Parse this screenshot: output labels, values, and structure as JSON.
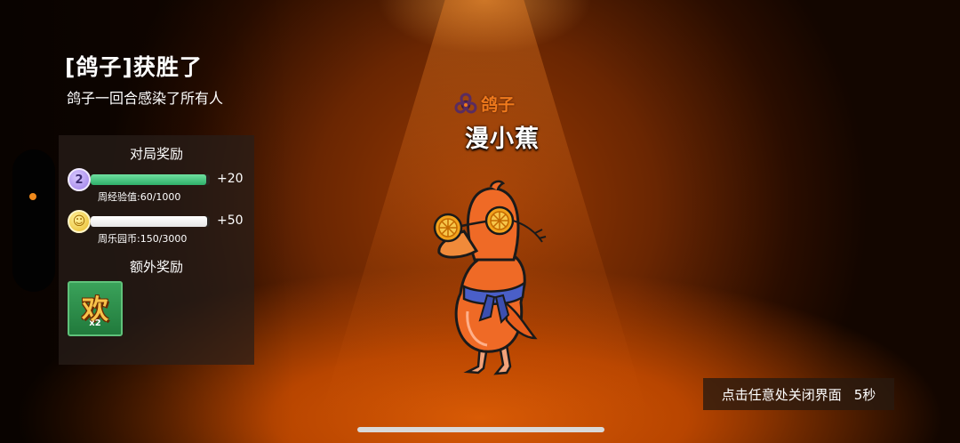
{
  "result": {
    "title": "[鸽子]获胜了",
    "subtitle": "鸽子一回合感染了所有人"
  },
  "rewards": {
    "match_title": "对局奖励",
    "exp": {
      "badge": "2",
      "gain": "+20",
      "progress_text": "周经验值:60/1000",
      "progress": 0.97
    },
    "coins": {
      "gain": "+50",
      "progress_text": "周乐园币:150/3000",
      "progress": 0.98
    },
    "extra_title": "额外奖励",
    "extra_item": {
      "glyph": "欢",
      "count": "x2"
    }
  },
  "player": {
    "role": "鸽子",
    "name": "漫小蕉",
    "role_icon": "biohazard-icon",
    "role_color": "#f07a1c"
  },
  "close_hint": {
    "text": "点击任意处关闭界面",
    "countdown": "5秒"
  }
}
